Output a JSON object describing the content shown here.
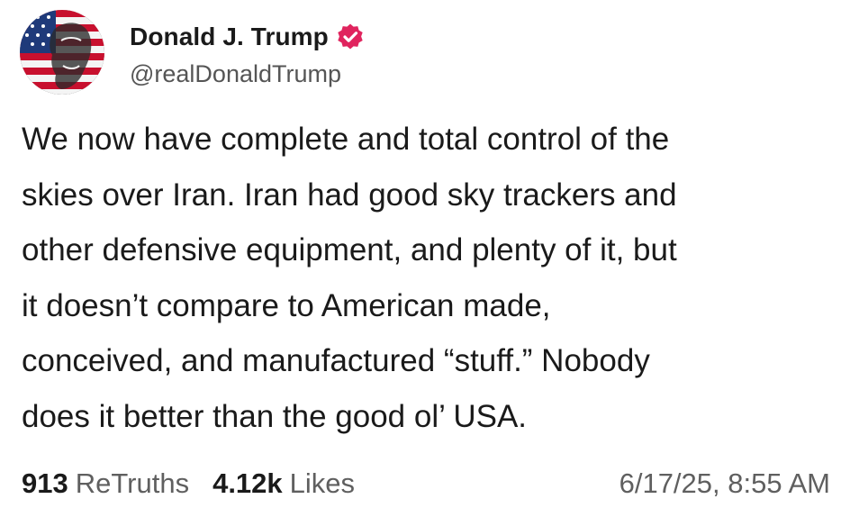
{
  "author": {
    "display_name": "Donald J. Trump",
    "handle": "@realDonaldTrump",
    "verified_icon": "verified-badge-icon",
    "avatar_icon": "flag-portrait-avatar",
    "verified_color": "#e0245e"
  },
  "post": {
    "text": "We now have complete and total control of the\nskies over Iran. Iran had good sky trackers and\nother defensive equipment, and plenty of it, but\nit doesn’t compare to American made,\nconceived, and manufactured “stuff.”  Nobody\ndoes it better than the good ol’ USA."
  },
  "stats": {
    "retruths_count": "913",
    "retruths_label": "ReTruths",
    "likes_count": "4.12k",
    "likes_label": "Likes"
  },
  "timestamp": "6/17/25, 8:55 AM",
  "colors": {
    "text": "#1a1a1a",
    "muted": "#5f5f5f",
    "background": "#ffffff"
  }
}
